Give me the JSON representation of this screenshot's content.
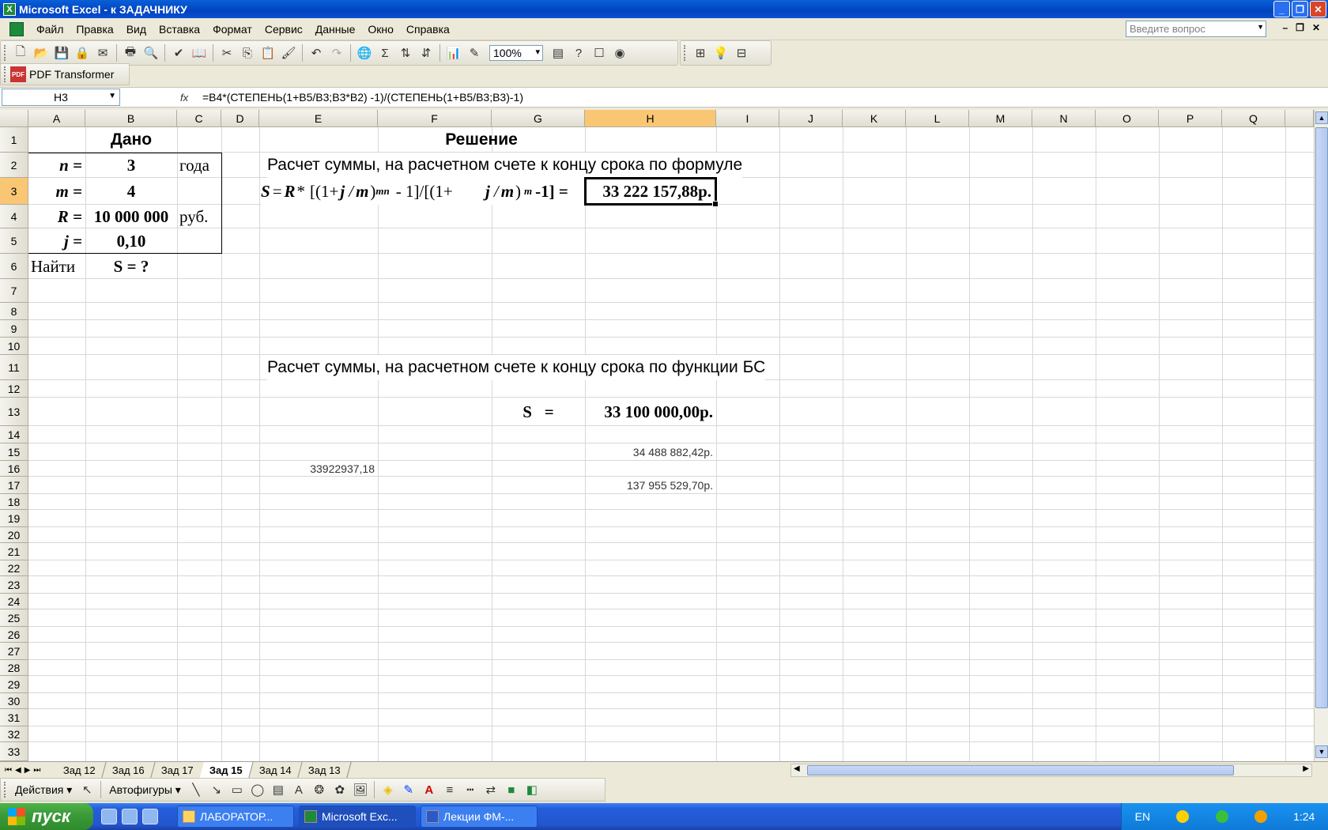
{
  "window": {
    "title": "Microsoft Excel - к ЗАДАЧНИКУ"
  },
  "menu": [
    "Файл",
    "Правка",
    "Вид",
    "Вставка",
    "Формат",
    "Сервис",
    "Данные",
    "Окно",
    "Справка"
  ],
  "help": {
    "placeholder": "Введите вопрос"
  },
  "toolbar": {
    "zoom": "100%"
  },
  "pdf_toolbar": {
    "label": "PDF Transformer"
  },
  "formula_bar": {
    "name_box": "H3",
    "fx": "fx",
    "formula": "=B4*(СТЕПЕНЬ(1+B5/B3;B3*B2) -1)/(СТЕПЕНЬ(1+B5/B3;B3)-1)"
  },
  "columns": [
    "A",
    "B",
    "C",
    "D",
    "E",
    "F",
    "G",
    "H",
    "I",
    "J",
    "K",
    "L",
    "M",
    "N",
    "O",
    "P",
    "Q"
  ],
  "rows": [
    "1",
    "2",
    "3",
    "4",
    "5",
    "6",
    "7",
    "8",
    "9",
    "10",
    "11",
    "12",
    "13",
    "14",
    "15",
    "16",
    "17",
    "18",
    "19",
    "20",
    "21",
    "22",
    "23",
    "24",
    "25",
    "26",
    "27",
    "28",
    "29",
    "30",
    "31",
    "32",
    "33"
  ],
  "cells": {
    "B1": "Дано",
    "A2": "n =",
    "B2": "3",
    "C2": "года",
    "A3": "m =",
    "B3": "4",
    "A4": "R =",
    "B4": "10 000 000",
    "C4": "руб.",
    "A5": "j =",
    "B5": "0,10",
    "A6": "Найти",
    "B6": "S = ?",
    "F1": "Решение",
    "E2": "Расчет суммы, на расчетном счете к концу срока по формуле",
    "E3": "S = R * [(1+ j / m )^mn - 1]/[(1+ j / m )^m -1] =",
    "H3": "33 222 157,88р.",
    "E11": "Расчет суммы, на расчетном счете к концу срока по функции БС",
    "G13": "S   =",
    "H13": "33 100 000,00р.",
    "H15": "34 488 882,42р.",
    "E16": "33922937,18",
    "H17": "137 955 529,70р."
  },
  "formula_parts": {
    "s": "S",
    "eq": "=",
    "r": "R",
    "star": "*",
    "open1": "[(1+",
    "j": "j",
    "slash": "/",
    "m": "m",
    "close": ")",
    "exp1": "mn",
    "minus1": "- 1]/[(1+",
    "exp2": "m",
    "minus2": "-1] ="
  },
  "sheet_tabs": [
    "Зад 12",
    "Зад 16",
    "Зад 17",
    "Зад 15",
    "Зад 14",
    "Зад 13"
  ],
  "active_tab": "Зад 15",
  "draw_toolbar": {
    "actions": "Действия ▾",
    "autoshapes": "Автофигуры ▾"
  },
  "taskbar": {
    "start": "пуск",
    "tasks": [
      "ЛАБОРАТОР...",
      "Microsoft Exc...",
      "Лекции ФМ-..."
    ],
    "lang": "EN",
    "clock": "1:24"
  }
}
